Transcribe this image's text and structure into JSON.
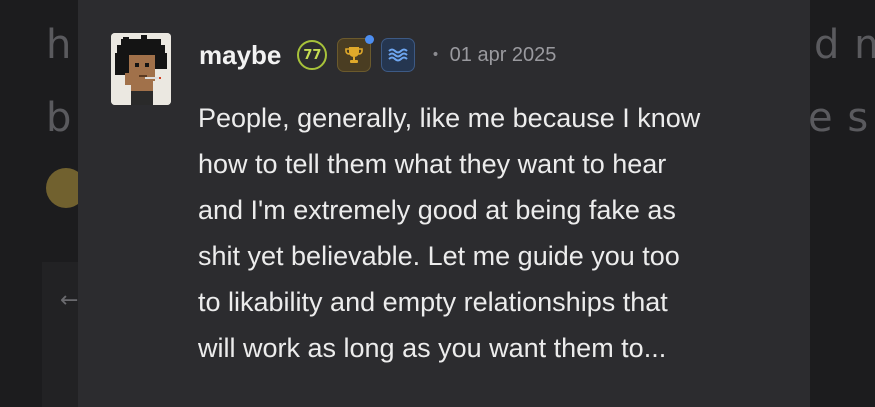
{
  "background": {
    "left_fragment_1": "h",
    "left_fragment_2": "b",
    "right_fragment_1": "d m",
    "right_fragment_2": "e s",
    "back_arrow": "←"
  },
  "post": {
    "author": {
      "username": "maybe",
      "level": "77",
      "badges": [
        "trophy-icon",
        "waves-icon"
      ]
    },
    "separator": "•",
    "date": "01 apr 2025",
    "lines": [
      "People, generally, like me because I know",
      "how to tell them what they want to hear",
      "and I'm extremely good at being fake as",
      "shit yet believable. Let me guide you too",
      "to likability and empty relationships that",
      "will work as long as you want them to..."
    ]
  },
  "colors": {
    "card_bg": "#2c2c2f",
    "level_accent": "#a7c23a",
    "trophy_accent": "#e0a92a",
    "wave_accent": "#6ea6f0",
    "notification_dot": "#4d8ef0"
  }
}
